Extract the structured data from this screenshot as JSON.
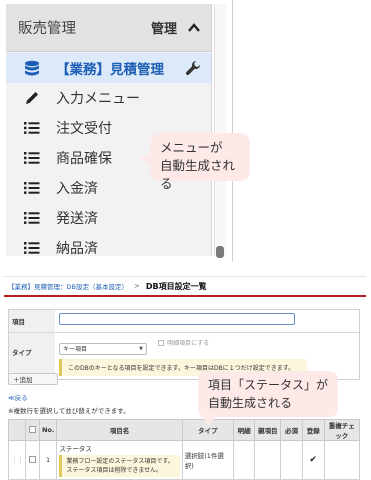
{
  "sidebar": {
    "title": "販売管理",
    "admin_label": "管理",
    "items": [
      {
        "label": "【業務】見積管理",
        "icon": "database-icon",
        "active": true
      },
      {
        "label": "入力メニュー",
        "icon": "pencil-icon"
      },
      {
        "label": "注文受付",
        "icon": "list-icon"
      },
      {
        "label": "商品確保",
        "icon": "list-icon"
      },
      {
        "label": "入金済",
        "icon": "list-icon"
      },
      {
        "label": "発送済",
        "icon": "list-icon"
      },
      {
        "label": "納品済",
        "icon": "list-icon"
      }
    ]
  },
  "callouts": {
    "menu_line1": "メニューが",
    "menu_line2": "自動生成される",
    "status_line1": "項目「ステータス」が",
    "status_line2": "自動生成される"
  },
  "db_settings": {
    "breadcrumb_link": "【業務】見積管理：DB設定（基本設定）",
    "breadcrumb_sep": ">",
    "breadcrumb_current": "DB項目設定一覧",
    "form": {
      "item_label": "項目",
      "item_value": "",
      "type_label": "タイプ",
      "type_selected": "キー項目",
      "detail_checkbox_label": "明細項目にする",
      "type_note": "このDBのキーとなる項目を設定できます。キー項目はDBに１つだけ設定できます。"
    },
    "add_button": "＋追加",
    "back_link": "≪戻る",
    "sort_hint": "※複数行を選択して並び替えができます。",
    "table": {
      "headers": [
        "",
        "",
        "No.",
        "項目名",
        "タイプ",
        "明細",
        "親項目",
        "必須",
        "登録",
        "重複チェック"
      ],
      "rows": [
        {
          "no": "1",
          "name": "ステータス",
          "note": "業務フロー設定のステータス項目です。ステータス項目は削除できません。",
          "type": "選択肢(1件選択)",
          "detail": "",
          "parent": "",
          "required": "",
          "registered": "✔",
          "dup_check": ""
        }
      ]
    }
  },
  "colors": {
    "active_bg": "#dce9f9",
    "link_blue": "#1d5fb4",
    "callout_pink": "#fde9e7",
    "accent_red": "#b42020",
    "note_yellow": "#fbf6dc"
  }
}
